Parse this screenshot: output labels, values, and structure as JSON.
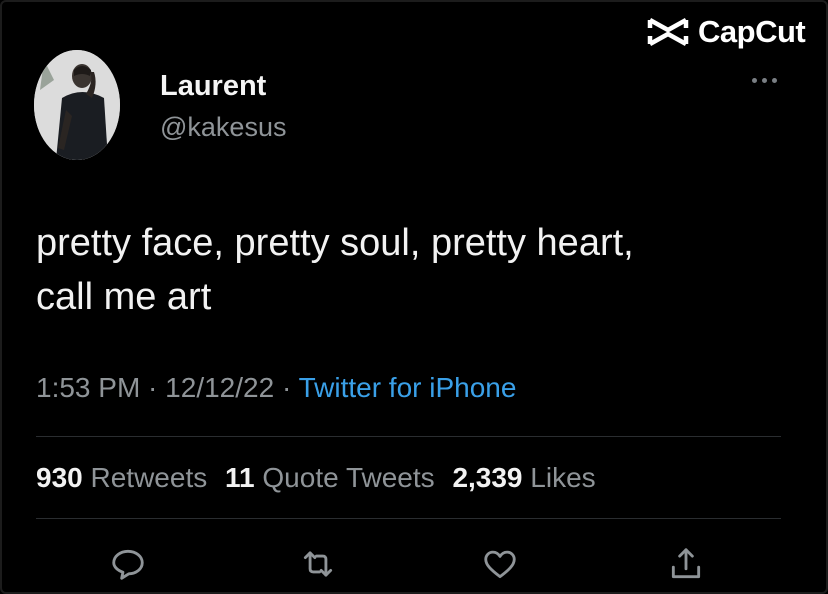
{
  "watermark": {
    "brand": "CapCut",
    "icon": "capcut-logo-icon"
  },
  "user": {
    "name": "Laurent",
    "handle": "@kakesus",
    "avatar_icon": "profile-photo"
  },
  "tweet": {
    "lines": [
      "pretty face, pretty soul, pretty heart,",
      "call me art"
    ]
  },
  "meta": {
    "time": "1:53 PM",
    "sep1": " · ",
    "date": "12/12/22",
    "sep2": " · ",
    "source": "Twitter for iPhone"
  },
  "stats": {
    "retweets_count": "930",
    "retweets_label": "Retweets",
    "quotes_count": "11",
    "quotes_label": "Quote Tweets",
    "likes_count": "2,339",
    "likes_label": "Likes"
  },
  "actions": [
    "reply-icon",
    "retweet-icon",
    "like-icon",
    "share-icon"
  ],
  "colors": {
    "background": "#000000",
    "link": "#3aa0e8",
    "muted": "#8f9498",
    "text": "#f2f2f2"
  }
}
